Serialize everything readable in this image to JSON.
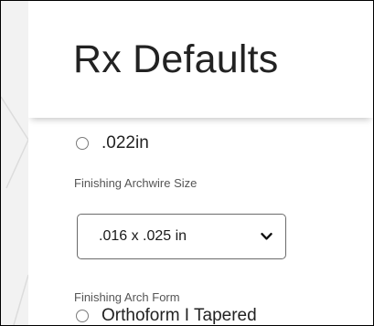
{
  "dialog": {
    "title": "Rx Defaults"
  },
  "fields": {
    "prev_option_label": ".022in",
    "archwire_size": {
      "label": "Finishing Archwire Size",
      "selected": ".016 x .025 in"
    },
    "arch_form": {
      "label": "Finishing Arch Form",
      "first_option_label": "Orthoform I Tapered"
    }
  },
  "icons": {
    "select_chevron": "chevron-down-icon",
    "radio": "radio-button-unselected"
  },
  "colors": {
    "background": "#ffffff",
    "side_background": "#f2f2f2",
    "text": "#222222",
    "label": "#555555",
    "border": "#6b6b6b"
  }
}
